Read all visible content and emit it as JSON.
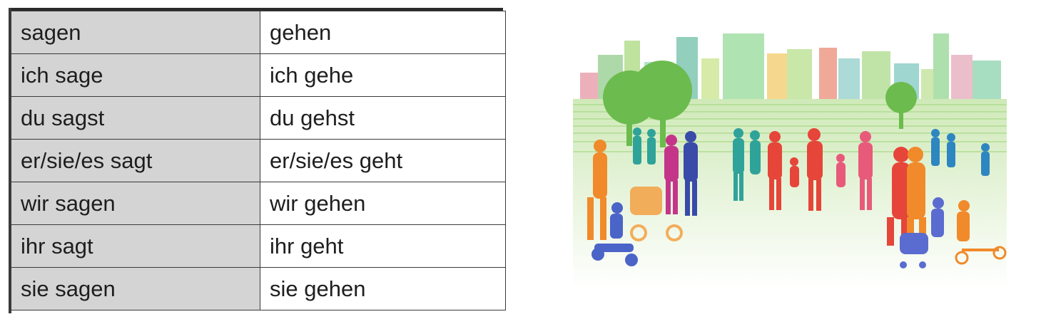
{
  "table": {
    "rows": [
      {
        "col1": "sagen",
        "col2": "gehen"
      },
      {
        "col1": "ich sage",
        "col2": "ich gehe"
      },
      {
        "col1": "du sagst",
        "col2": "du gehst"
      },
      {
        "col1": "er/sie/es sagt",
        "col2": "er/sie/es geht"
      },
      {
        "col1": "wir sagen",
        "col2": "wir gehen"
      },
      {
        "col1": "ihr sagt",
        "col2": "ihr geht"
      },
      {
        "col1": "sie sagen",
        "col2": "sie gehen"
      }
    ]
  },
  "illustration": {
    "subject": "colorful silhouettes of people walking in a city park with skyline",
    "colors": {
      "buildings": "#8fd3a8",
      "trees": "#78c25a",
      "orange": "#f08a2a",
      "red": "#e6453a",
      "magenta": "#c4358a",
      "blue": "#4a64c8",
      "teal": "#2fa39a"
    }
  }
}
